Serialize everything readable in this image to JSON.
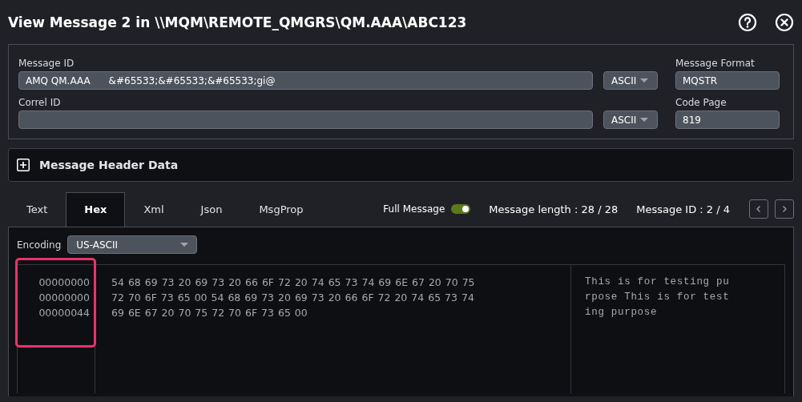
{
  "window": {
    "title": "View Message 2 in \\\\MQM\\REMOTE_QMGRS\\QM.AAA\\ABC123"
  },
  "fields": [
    {
      "label": "Message ID",
      "value": "AMQ QM.AAA      &#65533;&#65533;&#65533;gi@",
      "encoding": "ASCII",
      "side_label": "Message Format",
      "side_value": "MQSTR"
    },
    {
      "label": "Correl ID",
      "encoding": "ASCII",
      "side_label": "Code Page",
      "side_value": "819"
    }
  ],
  "header_section": {
    "title": "Message Header Data",
    "expanded": false
  },
  "tabs": [
    {
      "label": "Text",
      "selected": false
    },
    {
      "label": "Hex",
      "selected": true
    },
    {
      "label": "Xml",
      "selected": false
    },
    {
      "label": "Json",
      "selected": false
    },
    {
      "label": "MsgProp",
      "selected": false
    }
  ],
  "full_message": {
    "label": "Full Message",
    "on": true
  },
  "message_length": "Message length : 28 / 28",
  "message_id": "Message ID : 2 / 4",
  "encoding": {
    "label": "Encoding",
    "value": "US-ASCII"
  },
  "hex": {
    "addresses": [
      "00000000",
      "00000000",
      "00000044"
    ],
    "bytes": [
      "54 68 69 73 20 69 73 20 66 6F 72 20 74 65 73 74 69 6E 67 20 70 75",
      "72 70 6F 73 65 00 54 68 69 73 20 69 73 20 66 6F 72 20 74 65 73 74",
      "69 6E 67 20 70 75 72 70 6F 73 65 00"
    ],
    "text": [
      "This is for testing pu",
      "rpose This is for test",
      "ing purpose"
    ]
  }
}
